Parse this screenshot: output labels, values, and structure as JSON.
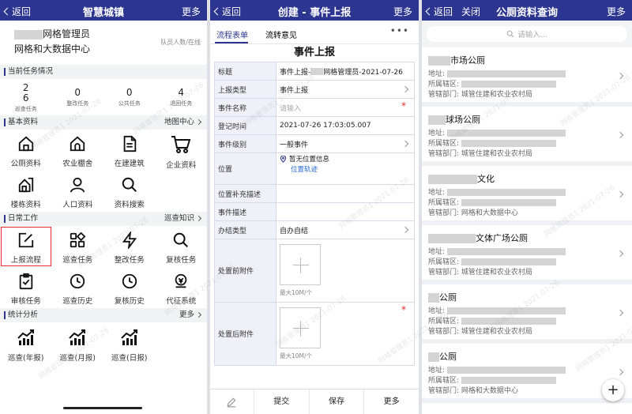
{
  "screen1": {
    "nav": {
      "back": "返回",
      "title": "智慧城镇",
      "more": "更多"
    },
    "user": {
      "name_suffix": "网格管理员",
      "dept": "网格和大数据中心",
      "team": "队员人数/在线"
    },
    "sections": {
      "tasks": "当前任务情况",
      "basic": "基本资料",
      "basic_right": "地图中心",
      "daily": "日常工作",
      "daily_right": "巡查知识",
      "stats": "统计分析",
      "stats_right": "更多"
    },
    "task_stats": [
      {
        "num": "2\n6",
        "label": "巡查任务"
      },
      {
        "num": "0",
        "label": "整改任务"
      },
      {
        "num": "0",
        "label": "公共任务"
      },
      {
        "num": "4",
        "label": "退回任务"
      }
    ],
    "basic_items": [
      {
        "label": "公厕资料",
        "icon": "house-icon"
      },
      {
        "label": "农业棚舍",
        "icon": "barn-icon"
      },
      {
        "label": "在建建筑",
        "icon": "document-icon"
      },
      {
        "label": "企业资料",
        "icon": "cart-icon"
      },
      {
        "label": "楼栋资料",
        "icon": "building-icon"
      },
      {
        "label": "人口资料",
        "icon": "person-icon"
      },
      {
        "label": "资料搜索",
        "icon": "search-icon"
      }
    ],
    "daily_items": [
      {
        "label": "上报流程",
        "icon": "edit-icon"
      },
      {
        "label": "巡查任务",
        "icon": "apps-icon"
      },
      {
        "label": "整改任务",
        "icon": "lightning-icon"
      },
      {
        "label": "复核任务",
        "icon": "search-icon"
      },
      {
        "label": "审核任务",
        "icon": "clipboard-check-icon"
      },
      {
        "label": "巡查历史",
        "icon": "clock-icon"
      },
      {
        "label": "复核历史",
        "icon": "clock-icon"
      },
      {
        "label": "代征系统",
        "icon": "tax-icon"
      }
    ],
    "stats_items": [
      {
        "label": "巡查(年报)",
        "icon": "trend-chart-icon"
      },
      {
        "label": "巡查(月报)",
        "icon": "trend-chart-icon"
      },
      {
        "label": "巡查(日报)",
        "icon": "trend-chart-icon"
      }
    ]
  },
  "screen2": {
    "nav": {
      "back": "返回",
      "title": "创建 - 事件上报",
      "more": "更多"
    },
    "tabs": [
      "流程表单",
      "流转意见"
    ],
    "form_title": "事件上报",
    "rows": {
      "title_label": "标题",
      "title_value_prefix": "事件上报-",
      "title_value_suffix": "网格管理员-2021-07-26",
      "type_label": "上报类型",
      "type_value": "事件上报",
      "name_label": "事件名称",
      "name_placeholder": "请输入",
      "time_label": "登记时间",
      "time_value": "2021-07-26 17:03:05.007",
      "level_label": "事件级别",
      "level_value": "一般事件",
      "loc_label": "位置",
      "loc_value": "暂无位置信息",
      "loc_link": "位置轨迹",
      "loc_extra_label": "位置补充描述",
      "desc_label": "事件描述",
      "handle_label": "办结类型",
      "handle_value": "自办自结",
      "before_label": "处置前附件",
      "before_cap": "最大10M/个",
      "after_label": "处置后附件",
      "after_cap": "最大10M/个"
    },
    "toolbar": {
      "submit": "提交",
      "save": "保存",
      "more": "更多"
    }
  },
  "screen3": {
    "nav": {
      "back": "返回",
      "close": "关闭",
      "title": "公厕资料查询",
      "more": "更多"
    },
    "search_placeholder": "请输入...",
    "field_labels": {
      "address": "地址:",
      "district": "所属辖区:",
      "dept": "管辖部门:"
    },
    "cards": [
      {
        "name": "市场公厕",
        "dept": "城管住建和农业农村局"
      },
      {
        "name": "球场公厕",
        "dept": "城管住建和农业农村局"
      },
      {
        "name": "文化",
        "dept": "网格和大数据中心"
      },
      {
        "name": "文体广场公厕",
        "dept": "城管住建和农业农村局"
      },
      {
        "name": "公厕",
        "dept": "城管住建和农业农村局"
      },
      {
        "name": "公厕",
        "dept": "网格和大数据中心"
      }
    ],
    "fab": "+"
  }
}
